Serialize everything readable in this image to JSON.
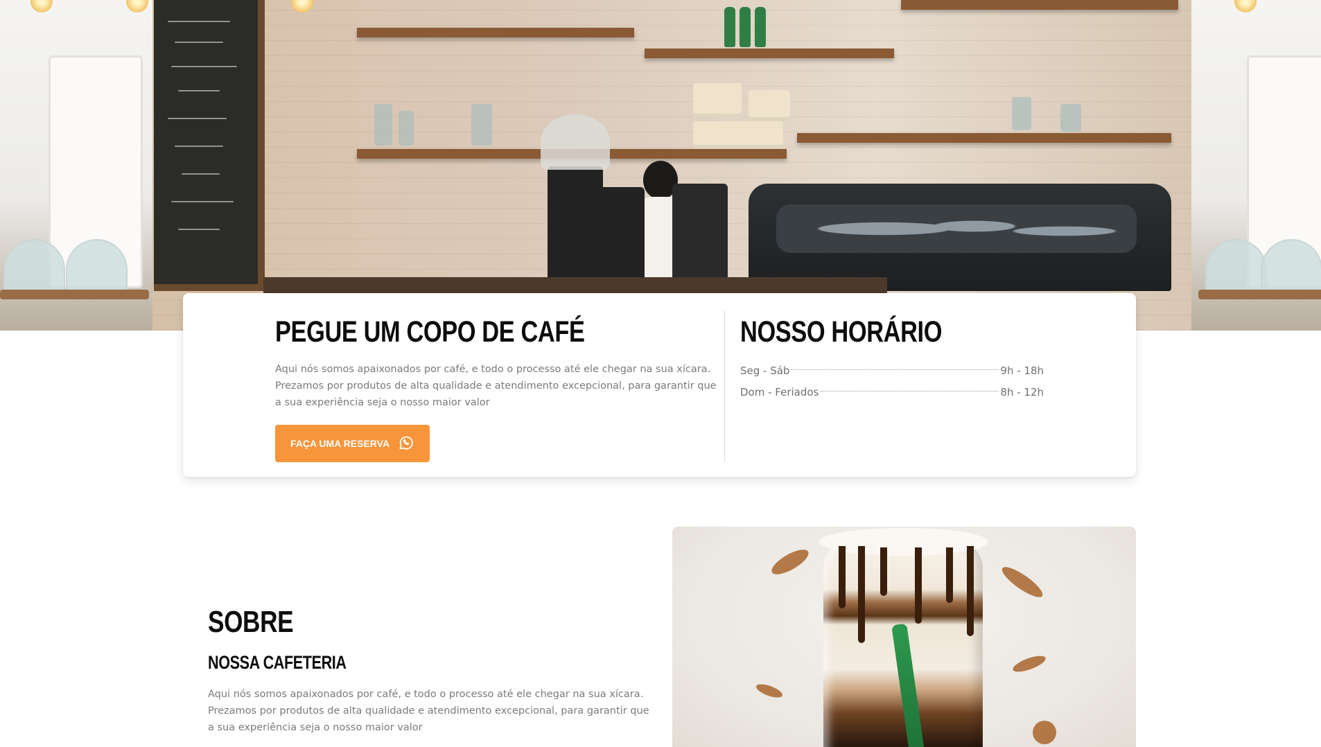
{
  "hero": {
    "image_description": "",
    "icons": [
      "pendant-bulb-icon"
    ]
  },
  "intro": {
    "title": "PEGUE UM COPO DE CAFÉ",
    "description": "Aqui nós somos apaixonados por café, e todo o processo até ele chegar na sua xícara. Prezamos por produtos de alta qualidade e atendimento excepcional, para garantir que a sua experiência seja o nosso maior valor",
    "cta_label": "FAÇA UMA RESERVA",
    "cta_icon": "whatsapp-icon"
  },
  "hours": {
    "title": "NOSSO HORÁRIO",
    "rows": [
      {
        "day": "Seg - Sáb",
        "time": "9h - 18h"
      },
      {
        "day": "Dom - Feriados",
        "time": "8h - 12h"
      }
    ]
  },
  "about": {
    "title": "SOBRE",
    "subtitle": "NOSSA CAFETERIA",
    "description": "Aqui nós somos apaixonados por café, e todo o processo até ele chegar na sua xícara. Prezamos por produtos de alta qualidade e atendimento excepcional, para garantir que a sua experiência seja o nosso maior valor"
  },
  "colors": {
    "accent": "#f7953b",
    "heading": "#0d0d0d",
    "body_text": "#7a7a7a",
    "divider": "#dddddd"
  }
}
